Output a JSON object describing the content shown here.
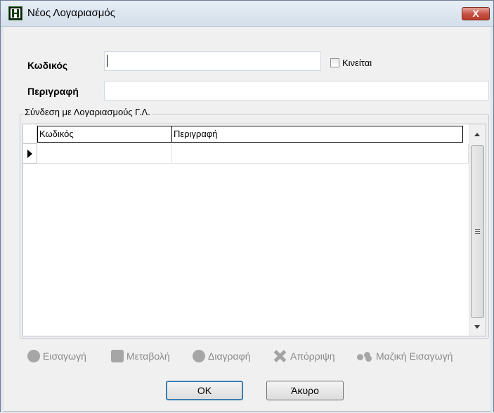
{
  "window": {
    "title": "Νέος Λογαριασμός",
    "close_label": "X"
  },
  "form": {
    "code_label": "Κωδικός",
    "code_value": "",
    "moves_label": "Κινείται",
    "moves_checked": false,
    "description_label": "Περιγραφή",
    "description_value": ""
  },
  "group": {
    "title": "Σύνδεση με Λογαριασμούς Γ.Λ.",
    "columns": [
      "Κωδικός",
      "Περιγραφή"
    ],
    "rows": [
      [
        "",
        ""
      ]
    ]
  },
  "toolbar": {
    "insert": "Εισαγωγή",
    "modify": "Μεταβολή",
    "delete": "Διαγραφή",
    "reject": "Απόρριψη",
    "bulk_insert": "Μαζική Εισαγωγή"
  },
  "buttons": {
    "ok": "OK",
    "cancel": "Άκυρο"
  },
  "colors": {
    "close_button": "#c5503f",
    "window_bg": "#f0f0f0",
    "disabled_icon": "#a6a6a6"
  }
}
